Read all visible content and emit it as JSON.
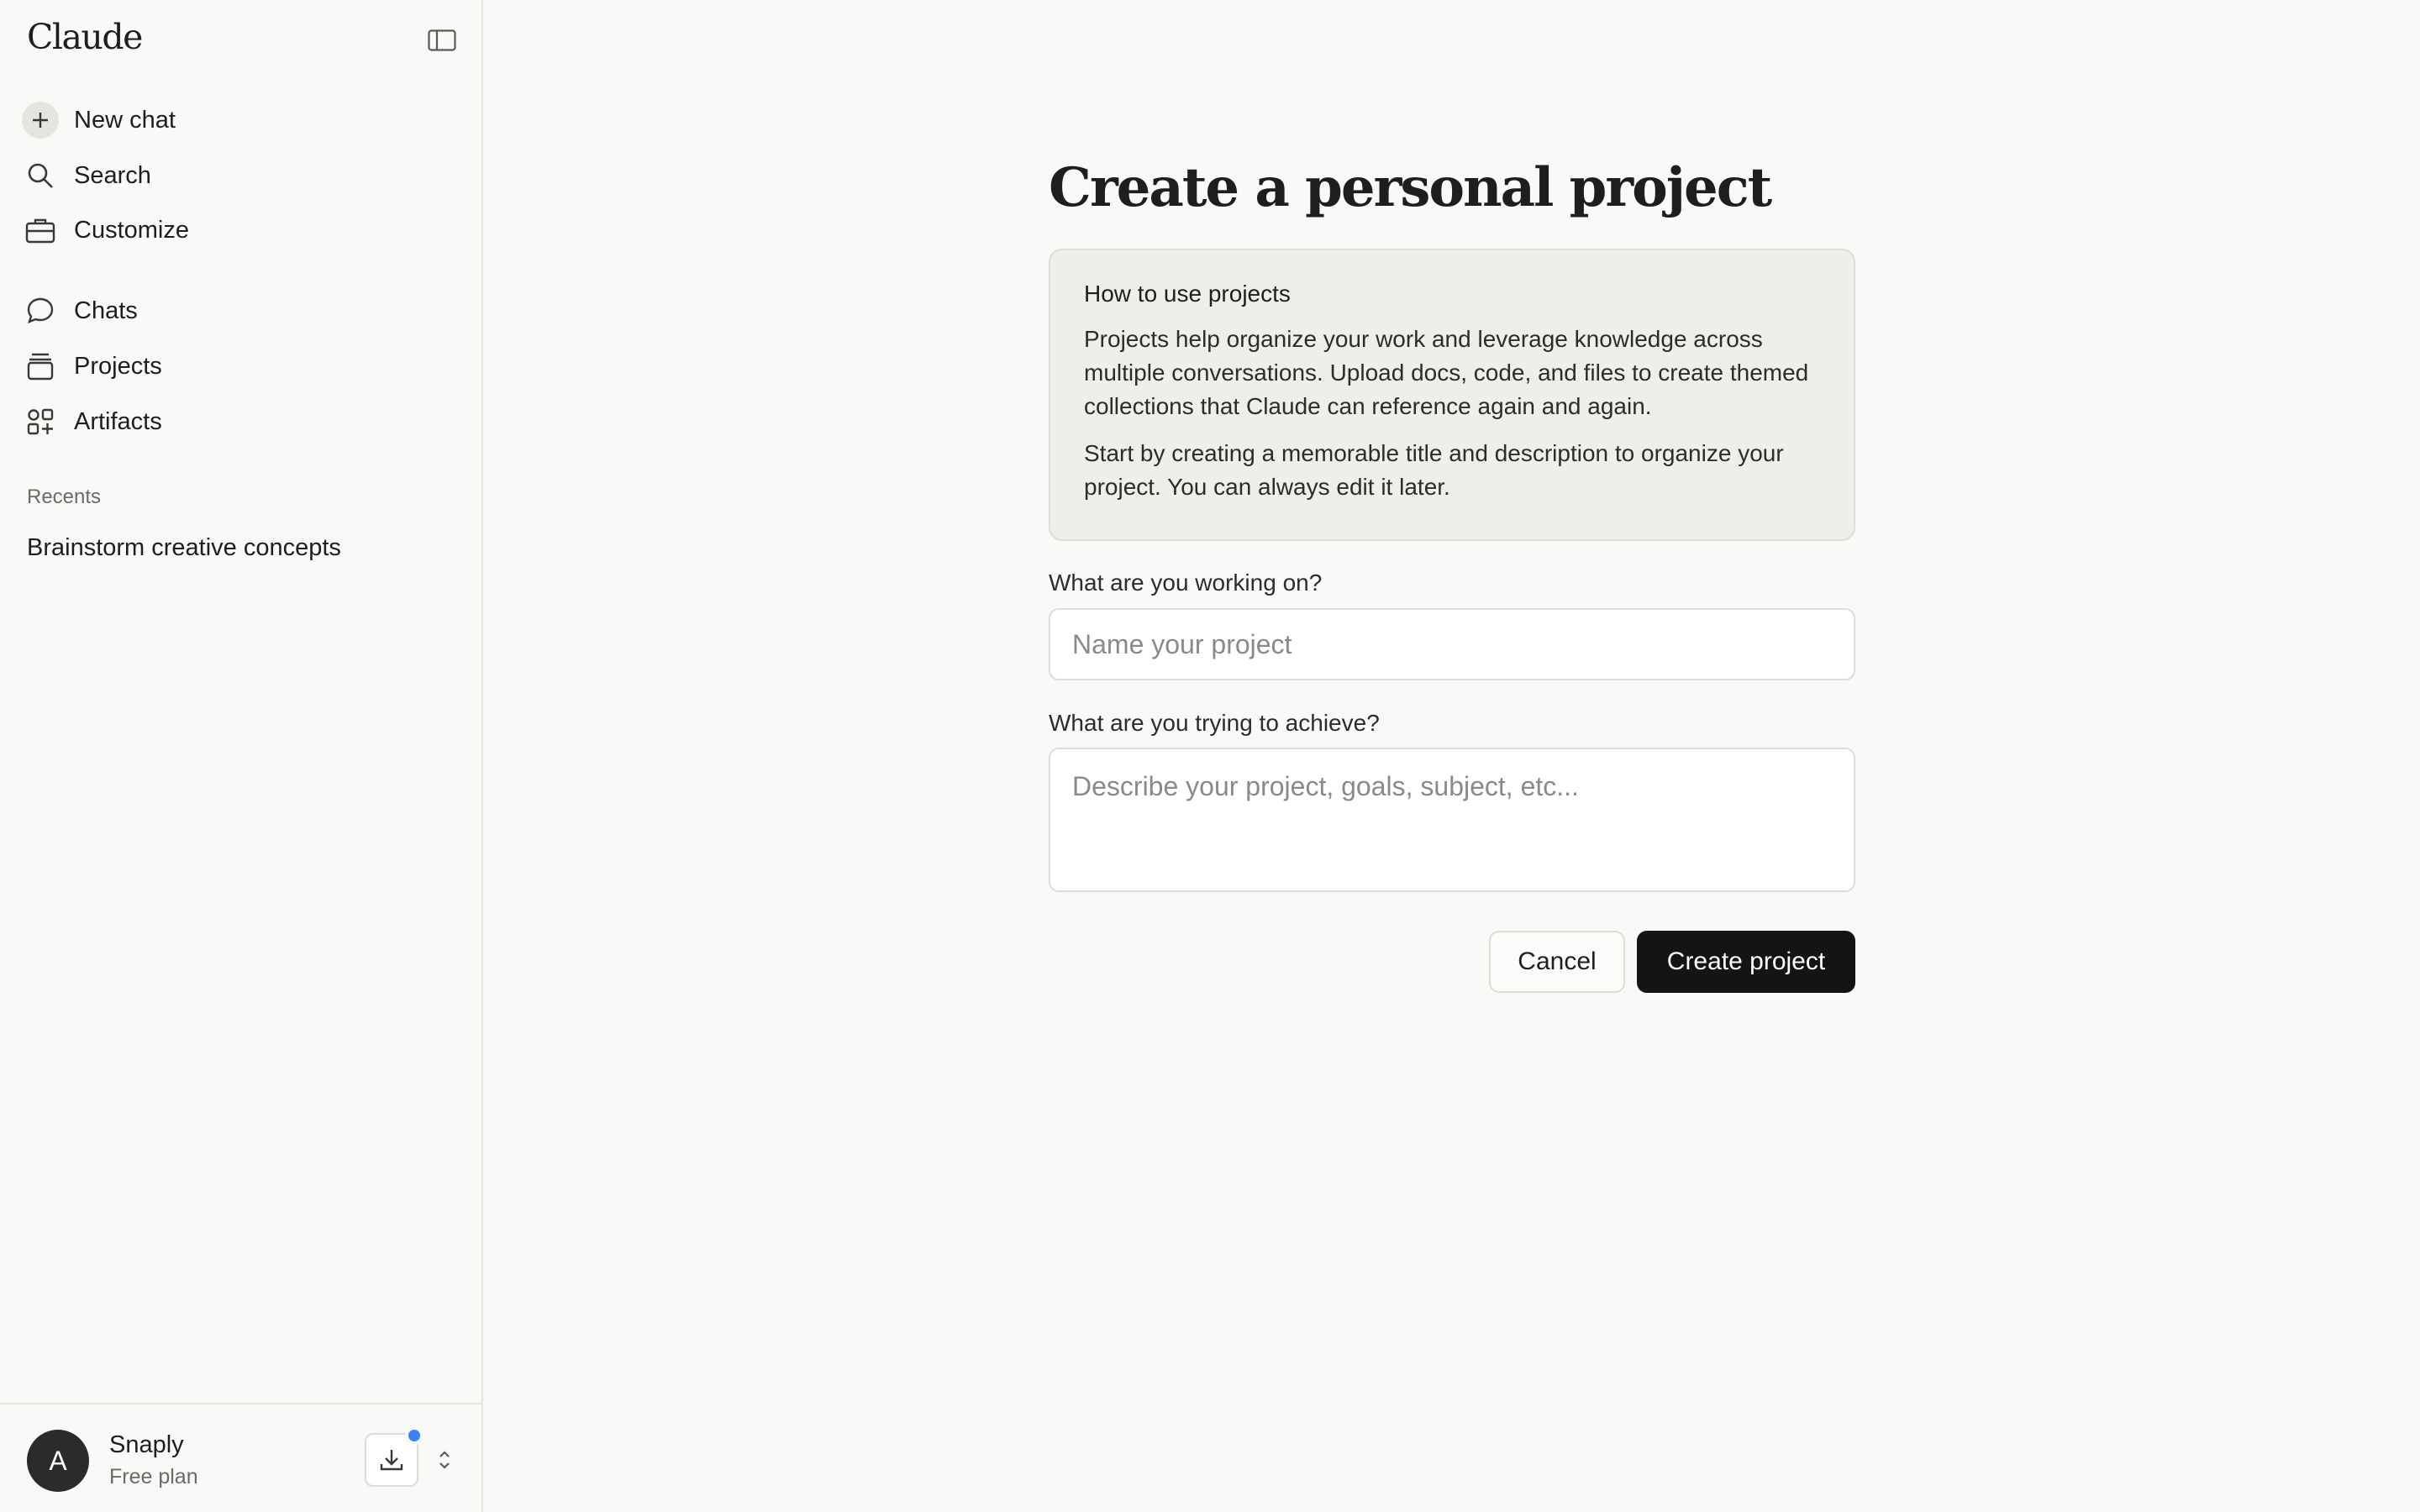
{
  "sidebar": {
    "logo": "Claude",
    "toggle_icon": "sidebar-toggle-icon",
    "primary_items": [
      {
        "label": "New chat",
        "icon": "plus-icon"
      },
      {
        "label": "Search",
        "icon": "search-icon"
      },
      {
        "label": "Customize",
        "icon": "briefcase-icon"
      }
    ],
    "secondary_items": [
      {
        "label": "Chats",
        "icon": "chat-bubble-icon"
      },
      {
        "label": "Projects",
        "icon": "folder-stack-icon"
      },
      {
        "label": "Artifacts",
        "icon": "artifacts-grid-icon"
      }
    ],
    "recents_label": "Recents",
    "recents": [
      "Brainstorm creative concepts"
    ],
    "user": {
      "avatar_initial": "A",
      "name": "Snaply",
      "plan": "Free plan"
    }
  },
  "main": {
    "title": "Create a personal project",
    "info": {
      "heading": "How to use projects",
      "paragraph_1": "Projects help organize your work and leverage knowledge across multiple conversations. Upload docs, code, and files to create themed collections that Claude can reference again and again.",
      "paragraph_2": "Start by creating a memorable title and description to organize your project. You can always edit it later."
    },
    "name_field": {
      "label": "What are you working on?",
      "placeholder": "Name your project",
      "value": ""
    },
    "description_field": {
      "label": "What are you trying to achieve?",
      "placeholder": "Describe your project, goals, subject, etc...",
      "value": ""
    },
    "cancel_label": "Cancel",
    "create_label": "Create project"
  },
  "colors": {
    "background": "#f9f9f7",
    "info_box": "#f0eeea",
    "primary_button": "#141413",
    "notification_dot": "#3b82f6"
  }
}
